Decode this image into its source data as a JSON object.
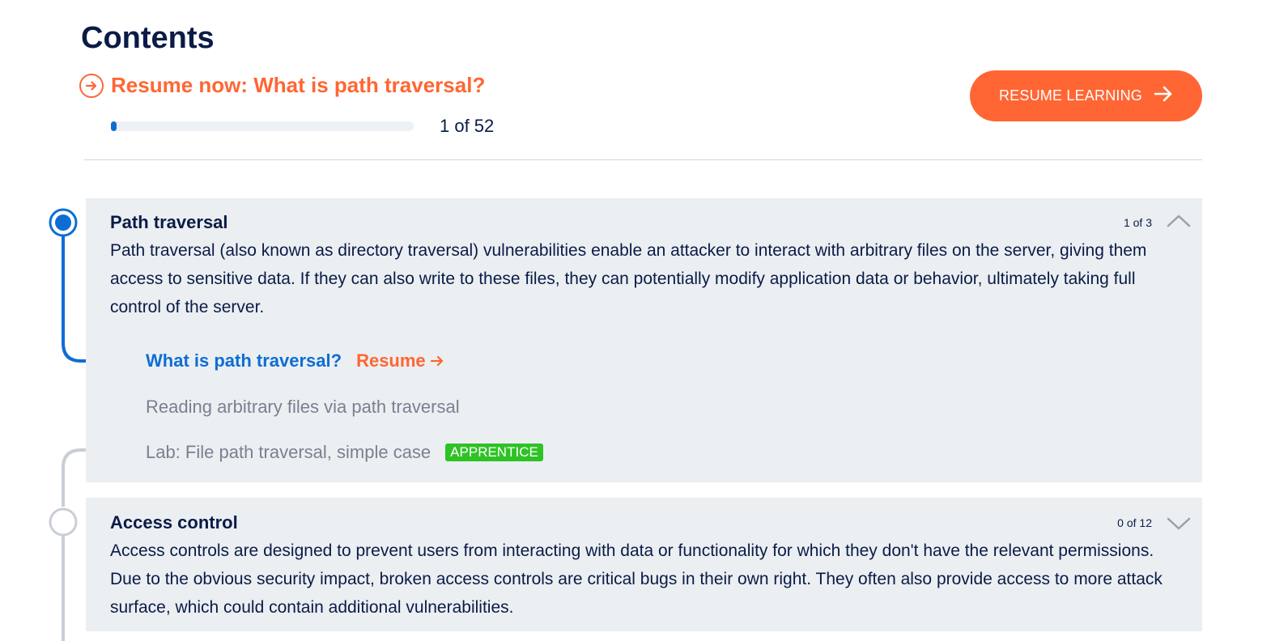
{
  "page": {
    "title": "Contents"
  },
  "resume_banner": {
    "text": "Resume now: What is path traversal?",
    "progress_text": "1 of 52",
    "progress_fraction": 0.019,
    "button_label": "RESUME LEARNING"
  },
  "colors": {
    "accent_orange": "#ff6633",
    "accent_blue": "#0e6dd4",
    "navy": "#0b1b47",
    "section_bg": "#ebeff2",
    "badge_green": "#2ec225"
  },
  "sections": [
    {
      "title": "Path traversal",
      "count": "1 of 3",
      "expanded": true,
      "description": "Path traversal (also known as directory traversal) vulnerabilities enable an attacker to interact with arbitrary files on the server, giving them access to sensitive data. If they can also write to these files, they can potentially modify application data or behavior, ultimately taking full control of the server.",
      "items": [
        {
          "label": "What is path traversal?",
          "active": true,
          "resume_label": "Resume"
        },
        {
          "label": "Reading arbitrary files via path traversal",
          "active": false
        },
        {
          "label": "Lab: File path traversal, simple case",
          "active": false,
          "badge": "APPRENTICE"
        }
      ]
    },
    {
      "title": "Access control",
      "count": "0 of 12",
      "expanded": false,
      "description": "Access controls are designed to prevent users from interacting with data or functionality for which they don't have the relevant permissions. Due to the obvious security impact, broken access controls are critical bugs in their own right. They often also provide access to more attack surface, which could contain additional vulnerabilities."
    }
  ],
  "icons": {
    "resume_now": "circle-arrow-right-icon",
    "button_arrow": "arrow-right-icon",
    "collapse": "chevron-up-icon",
    "expand": "chevron-down-icon"
  }
}
